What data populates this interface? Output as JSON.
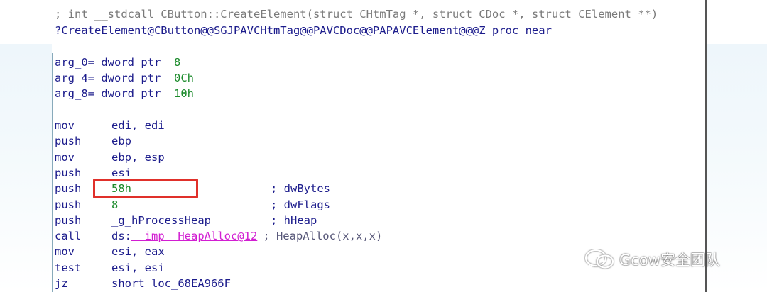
{
  "code": {
    "header_comment": "; int __stdcall CButton::CreateElement(struct CHtmTag *, struct CDoc *, struct CElement **)",
    "proc_name": "?CreateElement@CButton@@SGJPAVCHtmTag@@PAVCDoc@@PAPAVCElement@@@Z",
    "proc_kw": "proc near",
    "args": [
      {
        "name": "arg_0",
        "decl": "= dword ptr",
        "value": "8"
      },
      {
        "name": "arg_4",
        "decl": "= dword ptr",
        "value": "0Ch"
      },
      {
        "name": "arg_8",
        "decl": "= dword ptr",
        "value": "10h"
      }
    ],
    "instructions": [
      {
        "op": "mov",
        "arg": "edi, edi",
        "comment": ""
      },
      {
        "op": "push",
        "arg": "ebp",
        "comment": ""
      },
      {
        "op": "mov",
        "arg": "ebp, esp",
        "comment": ""
      },
      {
        "op": "push",
        "arg": "esi",
        "comment": ""
      },
      {
        "op": "push",
        "arg": "58h",
        "comment": "; dwBytes"
      },
      {
        "op": "push",
        "arg": "8",
        "comment": "; dwFlags"
      },
      {
        "op": "push",
        "arg": "_g_hProcessHeap",
        "comment": "; hHeap"
      },
      {
        "op": "call",
        "arg_prefix": "ds:",
        "arg": "__imp__HeapAlloc@12",
        "comment": "; HeapAlloc(x,x,x)"
      },
      {
        "op": "mov",
        "arg": "esi, eax",
        "comment": ""
      },
      {
        "op": "test",
        "arg": "esi, esi",
        "comment": ""
      },
      {
        "op": "jz",
        "arg": "short loc_68EA966F",
        "comment": ""
      }
    ],
    "highlight": "push 58h"
  },
  "watermark": {
    "text": "Gcow安全团队",
    "icon": "wechat-icon"
  },
  "colors": {
    "highlight_border": "#e0302a",
    "keyword": "#1c1c8c",
    "number": "#1a8a2a",
    "import": "#d21ed2",
    "comment": "#7a7a7a"
  }
}
